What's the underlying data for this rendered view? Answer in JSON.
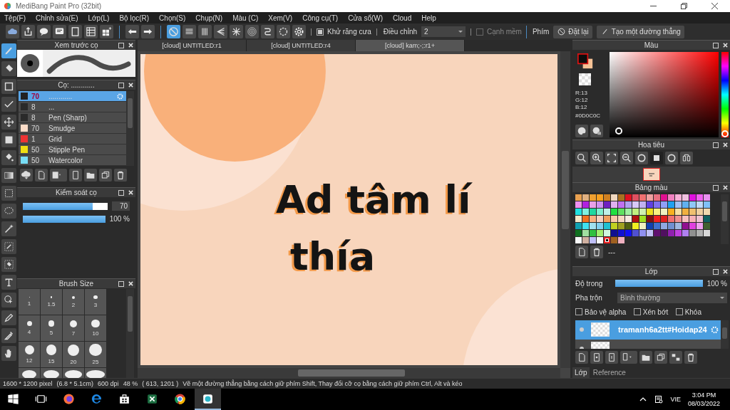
{
  "window": {
    "title": "MediBang Paint Pro (32bit)"
  },
  "menu": [
    "Tệp(F)",
    "Chỉnh sửa(E)",
    "Lớp(L)",
    "Bộ lọc(R)",
    "Chọn(S)",
    "Chụp(N)",
    "Màu (C)",
    "Xem(V)",
    "Công cụ(T)",
    "Cửa sổ(W)",
    "Cloud",
    "Help"
  ],
  "toolbar": {
    "snaps": [
      {
        "kind": "none",
        "selected": true
      },
      {
        "kind": "parallel",
        "selected": false
      },
      {
        "kind": "grid",
        "selected": false
      },
      {
        "kind": "perspective",
        "selected": false
      },
      {
        "kind": "radial",
        "selected": false
      },
      {
        "kind": "concentric",
        "selected": false
      },
      {
        "kind": "curve",
        "selected": false
      },
      {
        "kind": "circle",
        "selected": false
      }
    ],
    "antialias": {
      "label": "Khử răng cưa",
      "checked": true
    },
    "correction": {
      "label": "Điều chỉnh",
      "value": "2"
    },
    "soft_edge": {
      "label": "Cạnh mềm",
      "checked": false
    },
    "key_label": "Phím",
    "buttons": [
      {
        "kind": "reset",
        "label": "Đặt lại"
      },
      {
        "kind": "line",
        "label": "Tạo một đường thẳng"
      }
    ]
  },
  "tools": [
    {
      "kind": "brush",
      "selected": true
    },
    {
      "kind": "eraser",
      "selected": false
    },
    {
      "kind": "rect",
      "selected": false
    },
    {
      "kind": "polyline",
      "selected": false
    },
    {
      "kind": "move",
      "selected": false
    },
    {
      "kind": "fill",
      "selected": false
    },
    {
      "kind": "bucket",
      "selected": false
    },
    {
      "kind": "gradient",
      "selected": false
    },
    {
      "kind": "select",
      "selected": false
    },
    {
      "kind": "lasso",
      "selected": false
    },
    {
      "kind": "wand",
      "selected": false
    },
    {
      "kind": "selpen",
      "selected": false
    },
    {
      "kind": "selerase",
      "selected": false
    },
    {
      "kind": "text",
      "selected": false
    },
    {
      "kind": "operation",
      "selected": false
    },
    {
      "kind": "pen",
      "selected": false
    },
    {
      "kind": "dropper",
      "selected": false
    },
    {
      "kind": "hand",
      "selected": false
    }
  ],
  "brush_preview": {
    "title": "Xem trước cọ"
  },
  "brush_list": {
    "title": "Cọ: ............",
    "items": [
      {
        "color": "#222222",
        "size": "70",
        "name": "............",
        "selected": true
      },
      {
        "color": "#2a2a2a",
        "size": "8",
        "name": "...",
        "selected": false
      },
      {
        "color": "#2a2a2a",
        "size": "8",
        "name": "Pen (Sharp)",
        "selected": false
      },
      {
        "color": "#fbdcc8",
        "size": "70",
        "name": "Smudge",
        "selected": false
      },
      {
        "color": "#ee3333",
        "size": "1",
        "name": "Grid",
        "selected": false
      },
      {
        "color": "#eedd11",
        "size": "50",
        "name": "Stipple Pen",
        "selected": false
      },
      {
        "color": "#77ddf5",
        "size": "50",
        "name": "Watercolor",
        "selected": false
      }
    ]
  },
  "brush_control": {
    "title": "Kiểm soát cọ",
    "size": {
      "level": 0.82,
      "value": "70"
    },
    "opacity": {
      "level": 1,
      "reading": "100 %"
    }
  },
  "brush_size": {
    "title": "Brush Size",
    "sizes": [
      "1",
      "1.5",
      "2",
      "3",
      "4",
      "5",
      "7",
      "10",
      "12",
      "15",
      "20",
      "25"
    ]
  },
  "canvas_tabs": [
    {
      "label": "[cloud] UNTITLED:r1",
      "selected": false
    },
    {
      "label": "[cloud] UNTITLED:r4",
      "selected": false
    },
    {
      "label": "[cloud] kam;-;:r1+",
      "selected": true
    }
  ],
  "canvas": {
    "lines": [
      "Ad tâm lí",
      "thía"
    ]
  },
  "color_panel": {
    "title": "Màu",
    "r": "R:13",
    "g": "G:12",
    "b": "B:12",
    "hex": "#0D0C0C",
    "hue": {
      "level": 0
    }
  },
  "navigator": {
    "title": "Hoa tiêu"
  },
  "palette": {
    "title": "Bảng màu",
    "footer": "---",
    "swatches": [
      {
        "color": "#e8a050",
        "selected": false
      },
      {
        "color": "#e0b080",
        "selected": false
      },
      {
        "color": "#f0a030",
        "selected": false
      },
      {
        "color": "#f8a020",
        "selected": false
      },
      {
        "color": "#d08020",
        "selected": false
      },
      {
        "color": "#f0d8c0",
        "selected": false
      },
      {
        "color": "#a87020",
        "selected": false
      },
      {
        "color": "#e01020",
        "selected": false
      },
      {
        "color": "#e05060",
        "selected": false
      },
      {
        "color": "#f07070",
        "selected": false
      },
      {
        "color": "#f0a0a0",
        "selected": false
      },
      {
        "color": "#e87080",
        "selected": false
      },
      {
        "color": "#e01090",
        "selected": false
      },
      {
        "color": "#f080c0",
        "selected": false
      },
      {
        "color": "#f8b0d8",
        "selected": false
      },
      {
        "color": "#f0c0e0",
        "selected": false
      },
      {
        "color": "#e010e0",
        "selected": false
      },
      {
        "color": "#f060f0",
        "selected": false
      },
      {
        "color": "#e890f0",
        "selected": false
      },
      {
        "color": "#f090f0",
        "selected": false
      },
      {
        "color": "#b020e0",
        "selected": false
      },
      {
        "color": "#e8a0e8",
        "selected": false
      },
      {
        "color": "#d090f0",
        "selected": false
      },
      {
        "color": "#7020c0",
        "selected": false
      },
      {
        "color": "#e0b0f0",
        "selected": false
      },
      {
        "color": "#c070f0",
        "selected": false
      },
      {
        "color": "#b0a0f0",
        "selected": false
      },
      {
        "color": "#d8c8f8",
        "selected": false
      },
      {
        "color": "#c0b0f0",
        "selected": false
      },
      {
        "color": "#6040e0",
        "selected": false
      },
      {
        "color": "#8070f0",
        "selected": false
      },
      {
        "color": "#90a0f8",
        "selected": false
      },
      {
        "color": "#20a0f0",
        "selected": false
      },
      {
        "color": "#a0c0f8",
        "selected": false
      },
      {
        "color": "#60b0f0",
        "selected": false
      },
      {
        "color": "#90c8f8",
        "selected": false
      },
      {
        "color": "#c0d8f8",
        "selected": false
      },
      {
        "color": "#80c0f8",
        "selected": false
      },
      {
        "color": "#20e0e0",
        "selected": false
      },
      {
        "color": "#80f0e0",
        "selected": false
      },
      {
        "color": "#20d8a0",
        "selected": false
      },
      {
        "color": "#80f0d0",
        "selected": false
      },
      {
        "color": "#c0f0e8",
        "selected": false
      },
      {
        "color": "#20e040",
        "selected": false
      },
      {
        "color": "#60e060",
        "selected": false
      },
      {
        "color": "#a0f0a0",
        "selected": false
      },
      {
        "color": "#c0f080",
        "selected": false
      },
      {
        "color": "#d0f0b0",
        "selected": false
      },
      {
        "color": "#f0e020",
        "selected": false
      },
      {
        "color": "#f8f080",
        "selected": false
      },
      {
        "color": "#f0f0c0",
        "selected": false
      },
      {
        "color": "#f8b020",
        "selected": false
      },
      {
        "color": "#f8e0a0",
        "selected": false
      },
      {
        "color": "#f0b040",
        "selected": false
      },
      {
        "color": "#f0c070",
        "selected": false
      },
      {
        "color": "#f0d0a0",
        "selected": false
      },
      {
        "color": "#f0d8b0",
        "selected": false
      },
      {
        "color": "#f8e8c8",
        "selected": false
      },
      {
        "color": "#f07020",
        "selected": false
      },
      {
        "color": "#f8b080",
        "selected": false
      },
      {
        "color": "#f8d0c0",
        "selected": false
      },
      {
        "color": "#f0a060",
        "selected": false
      },
      {
        "color": "#f8c8a8",
        "selected": false
      },
      {
        "color": "#f8d8c0",
        "selected": false
      },
      {
        "color": "#f8e8e0",
        "selected": false
      },
      {
        "color": "#b01010",
        "selected": false
      },
      {
        "color": "#a0e020",
        "selected": false
      },
      {
        "color": "#801010",
        "selected": false
      },
      {
        "color": "#f02020",
        "selected": false
      },
      {
        "color": "#e02020",
        "selected": false
      },
      {
        "color": "#f07070",
        "selected": false
      },
      {
        "color": "#f09090",
        "selected": false
      },
      {
        "color": "#f8c0c0",
        "selected": false
      },
      {
        "color": "#f8b0b8",
        "selected": false
      },
      {
        "color": "#f0c0d0",
        "selected": false
      },
      {
        "color": "#106060",
        "selected": false
      },
      {
        "color": "#10a0b0",
        "selected": false
      },
      {
        "color": "#40e0f0",
        "selected": false
      },
      {
        "color": "#a0e0f0",
        "selected": false
      },
      {
        "color": "#80d0f0",
        "selected": false
      },
      {
        "color": "#20c0d0",
        "selected": false
      },
      {
        "color": "#c0d020",
        "selected": false
      },
      {
        "color": "#a0a020",
        "selected": false
      },
      {
        "color": "#506010",
        "selected": false
      },
      {
        "color": "#f0f020",
        "selected": false
      },
      {
        "color": "#f0f0c0",
        "selected": false
      },
      {
        "color": "#1040b0",
        "selected": false
      },
      {
        "color": "#4070d0",
        "selected": false
      },
      {
        "color": "#90a8e0",
        "selected": false
      },
      {
        "color": "#7090d0",
        "selected": false
      },
      {
        "color": "#a0b8e0",
        "selected": false
      },
      {
        "color": "#901090",
        "selected": false
      },
      {
        "color": "#e040e0",
        "selected": false
      },
      {
        "color": "#f0a0f0",
        "selected": false
      },
      {
        "color": "#406030",
        "selected": false
      },
      {
        "color": "#107020",
        "selected": false
      },
      {
        "color": "#a0e0a0",
        "selected": false
      },
      {
        "color": "#30c040",
        "selected": false
      },
      {
        "color": "#a0f070",
        "selected": false
      },
      {
        "color": "#d0f8e0",
        "selected": false
      },
      {
        "color": "#101090",
        "selected": false
      },
      {
        "color": "#1010d0",
        "selected": false
      },
      {
        "color": "#1010f0",
        "selected": false
      },
      {
        "color": "#5050d0",
        "selected": false
      },
      {
        "color": "#9090f0",
        "selected": false
      },
      {
        "color": "#c0c0f8",
        "selected": false
      },
      {
        "color": "#601070",
        "selected": false
      },
      {
        "color": "#501060",
        "selected": false
      },
      {
        "color": "#9020b0",
        "selected": false
      },
      {
        "color": "#c040e0",
        "selected": false
      },
      {
        "color": "#b080f0",
        "selected": false
      },
      {
        "color": "#909090",
        "selected": false
      },
      {
        "color": "#b0b0b0",
        "selected": false
      },
      {
        "color": "#d8d8d8",
        "selected": false
      },
      {
        "color": "#f8f8f8",
        "selected": false
      },
      {
        "color": "#d0b0a0",
        "selected": false
      },
      {
        "color": "#c0c0f8",
        "selected": false
      },
      {
        "color": "#f8f8f8",
        "selected": false
      },
      {
        "color": "#101010",
        "selected": true
      },
      {
        "color": "#a06020",
        "selected": false
      },
      {
        "color": "#f0b0c0",
        "selected": false
      }
    ]
  },
  "layers": {
    "title": "Lớp",
    "opacity": {
      "label": "Độ trong",
      "level": 1,
      "reading": "100 %"
    },
    "blend": {
      "label": "Pha trộn",
      "value": "Bình thường"
    },
    "options": [
      {
        "label": "Bảo vệ alpha",
        "checked": false
      },
      {
        "label": "Xén bớt",
        "checked": false
      },
      {
        "label": "Khóa",
        "checked": false
      }
    ],
    "items": [
      {
        "name": "tramanh6a2tt#Hoidap24",
        "selected": true
      },
      {
        "selected": false
      }
    ],
    "tabs": [
      {
        "label": "Lớp",
        "selected": true
      },
      {
        "label": "Reference",
        "selected": false
      }
    ]
  },
  "status_bar": {
    "fields": [
      "1600 * 1200 pixel",
      "(6.8 * 5.1cm)",
      "600 dpi",
      "48 %",
      "( 613, 1201 )"
    ],
    "hint": "Vẽ một đường thẳng bằng cách giữ phím Shift, Thay đổi cỡ cọ bằng cách giữ phím Ctrl, Alt và kéo"
  },
  "taskbar": {
    "apps": [
      {
        "kind": "start",
        "active": false
      },
      {
        "kind": "taskview",
        "active": false
      },
      {
        "kind": "firefox",
        "active": false
      },
      {
        "kind": "edge",
        "active": false
      },
      {
        "kind": "store",
        "active": false
      },
      {
        "kind": "excel",
        "active": false
      },
      {
        "kind": "chrome",
        "active": false
      },
      {
        "kind": "medibang",
        "active": true
      }
    ],
    "language": "VIE",
    "time": "3:04 PM",
    "date": "08/03/2022"
  }
}
